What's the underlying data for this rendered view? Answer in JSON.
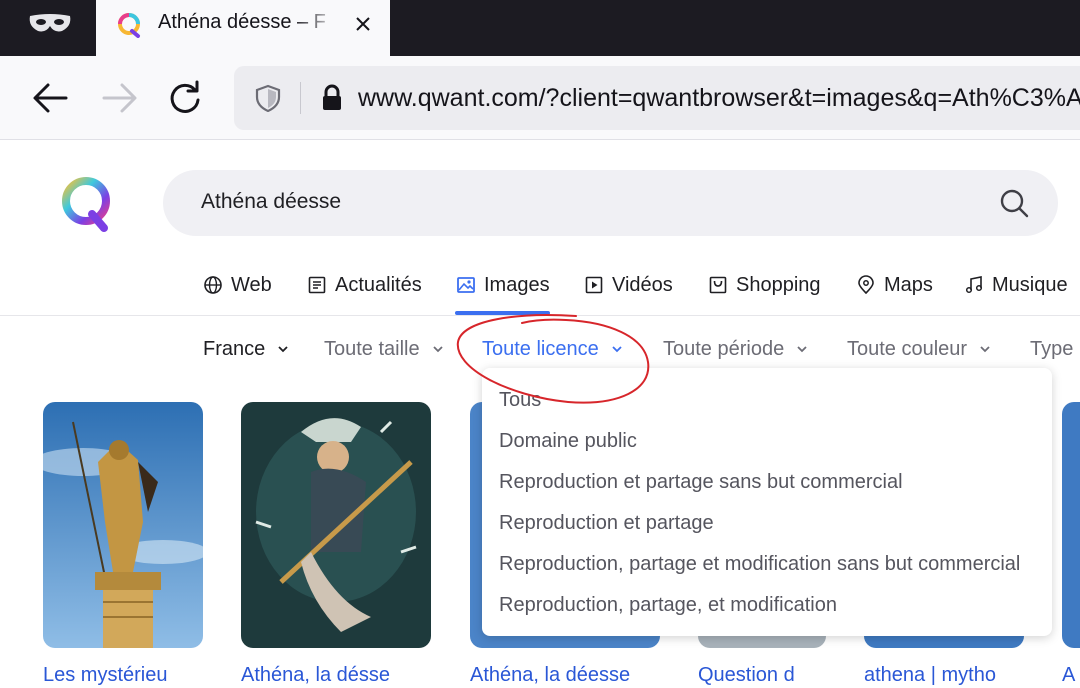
{
  "browser": {
    "tab": {
      "title": "Athéna déesse – F",
      "close_icon": "close-icon",
      "favicon": "qwant-logo"
    },
    "private_icon": "private-mask-icon",
    "url": "www.qwant.com/?client=qwantbrowser&t=images&q=Ath%C3%A"
  },
  "search": {
    "value": "Athéna déesse",
    "icon": "search-icon"
  },
  "verticals": [
    {
      "label": "Web",
      "icon": "globe-icon"
    },
    {
      "label": "Actualités",
      "icon": "newspaper-icon"
    },
    {
      "label": "Images",
      "icon": "image-icon",
      "active": true
    },
    {
      "label": "Vidéos",
      "icon": "play-icon"
    },
    {
      "label": "Shopping",
      "icon": "bag-icon"
    },
    {
      "label": "Maps",
      "icon": "map-pin-icon"
    },
    {
      "label": "Musique",
      "icon": "music-note-icon"
    }
  ],
  "filters": [
    {
      "label": "France",
      "state": "selected"
    },
    {
      "label": "Toute taille",
      "state": "default"
    },
    {
      "label": "Toute licence",
      "state": "open"
    },
    {
      "label": "Toute période",
      "state": "default"
    },
    {
      "label": "Toute couleur",
      "state": "default"
    },
    {
      "label": "Type",
      "state": "default"
    }
  ],
  "license_menu": {
    "options": [
      "Tous",
      "Domaine public",
      "Reproduction et partage sans but commercial",
      "Reproduction et partage",
      "Reproduction, partage et modification sans but commercial",
      "Reproduction, partage, et modification"
    ]
  },
  "results": [
    {
      "caption": "Les mystérieu"
    },
    {
      "caption": "Athéna, la désse"
    },
    {
      "caption": "Athéna, la déesse"
    },
    {
      "caption": "Question d"
    },
    {
      "caption": "athena | mytho"
    },
    {
      "caption": "A"
    }
  ],
  "colors": {
    "accent": "#3b6ff0",
    "annotation": "#d7262b",
    "link": "#2a57d6"
  }
}
